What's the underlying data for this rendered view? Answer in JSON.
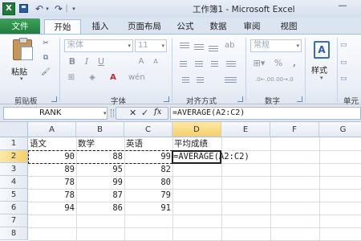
{
  "window": {
    "title": "工作簿1 - Microsoft Excel",
    "app_icon_text": "X",
    "quick_access": {
      "undo_glyph": "↶",
      "redo_glyph": "↷",
      "dropdown_glyph": "▾",
      "separator_glyph": "|",
      "minimize_glyph": "—"
    }
  },
  "tabs": {
    "file": "文件",
    "home": "开始",
    "insert": "插入",
    "page_layout": "页面布局",
    "formulas": "公式",
    "data": "数据",
    "review": "审阅",
    "view": "视图"
  },
  "ribbon": {
    "clipboard": {
      "group_label": "剪贴板",
      "paste_label": "粘贴",
      "cut_glyph": "✂",
      "copy_glyph": "⧉",
      "format_painter_glyph": "🖌",
      "dropdown_glyph": "▾"
    },
    "font": {
      "group_label": "字体",
      "font_name": "宋体",
      "font_size": "11",
      "bold": "B",
      "italic": "I",
      "underline": "U",
      "grow": "A",
      "shrink": "A",
      "border_glyph": "⊞",
      "fill_glyph": "◈",
      "color_glyph": "A",
      "phonetic_glyph": "wén",
      "dropdown_glyph": "▾"
    },
    "alignment": {
      "group_label": "对齐方式",
      "orientation_glyph": "ab"
    },
    "number": {
      "group_label": "数字",
      "format": "常规",
      "currency_glyph": "⊞▾",
      "percent": "%",
      "comma": ",",
      "increase_decimal": ".0←.00",
      "decrease_decimal": ".00→.0",
      "dropdown_glyph": "▾"
    },
    "styles": {
      "label": "样式",
      "icon_text": "A",
      "dropdown_glyph": "▾"
    },
    "cells": {
      "group_label": "单元",
      "insert_glyph": "▭",
      "delete_glyph": "▭",
      "format_glyph": "▭"
    }
  },
  "formula_bar": {
    "name_box": "RANK",
    "name_box_dropdown": "▾",
    "cancel_glyph": "✕",
    "enter_glyph": "✓",
    "insert_function": "fx",
    "formula": "=AVERAGE(A2:C2)"
  },
  "sheet": {
    "columns": [
      "A",
      "B",
      "C",
      "D",
      "E",
      "F",
      "G"
    ],
    "rows": [
      "1",
      "2",
      "3",
      "4",
      "5",
      "6",
      "7",
      "8"
    ],
    "headers": [
      "语文",
      "数学",
      "英语",
      "平均成绩"
    ],
    "data": [
      [
        "90",
        "88",
        "99"
      ],
      [
        "89",
        "95",
        "82"
      ],
      [
        "78",
        "99",
        "80"
      ],
      [
        "78",
        "87",
        "79"
      ],
      [
        "94",
        "86",
        "91"
      ]
    ],
    "editing_cell_text": "=AVERAGE(A2:C2)",
    "active_cell": "D2"
  },
  "colors": {
    "file_tab": "#1f7a3c",
    "active_header_highlight": "#f6cf6a",
    "gridline": "#d8dde5"
  }
}
